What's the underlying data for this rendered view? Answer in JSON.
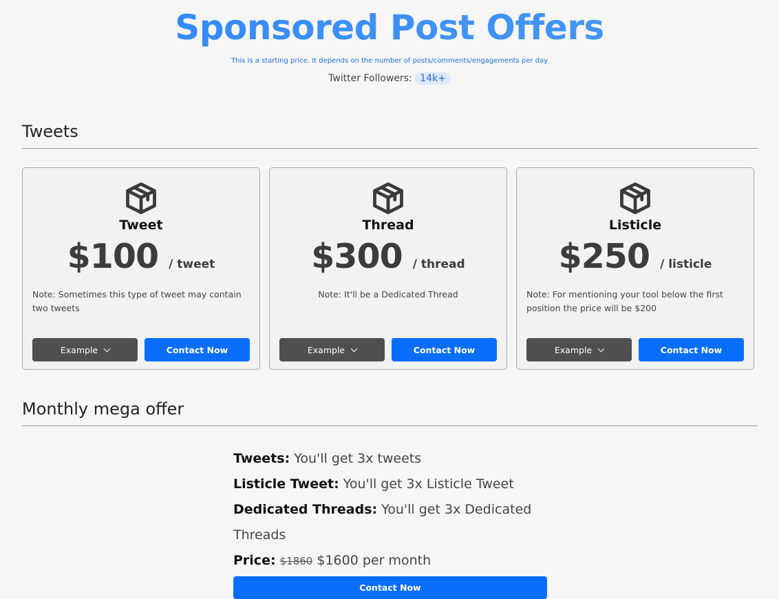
{
  "header": {
    "title": "Sponsored Post Offers",
    "subtitle": "This is a starting price. It depends on the number of posts/comments/engagements per day",
    "followers_label": "Twitter Followers:",
    "followers_count": "14k+"
  },
  "sections": {
    "tweets_title": "Tweets",
    "mega_title": "Monthly mega offer"
  },
  "cards": [
    {
      "icon": "box-icon",
      "name": "Tweet",
      "price": "$100",
      "per": "/ tweet",
      "note": "Note: Sometimes this type of tweet may contain two tweets",
      "example_label": "Example",
      "contact_label": "Contact Now"
    },
    {
      "icon": "box-icon",
      "name": "Thread",
      "price": "$300",
      "per": "/ thread",
      "note": "Note: It'll be a Dedicated Thread",
      "example_label": "Example",
      "contact_label": "Contact Now"
    },
    {
      "icon": "box-icon",
      "name": "Listicle",
      "price": "$250",
      "per": "/ listicle",
      "note": "Note: For mentioning your tool below the first position the price will be $200",
      "example_label": "Example",
      "contact_label": "Contact Now"
    }
  ],
  "mega": {
    "tweets_label": "Tweets:",
    "tweets_value": "You'll get 3x tweets",
    "listicle_label": "Listicle Tweet:",
    "listicle_value": "You'll get 3x Listicle Tweet",
    "threads_label": "Dedicated Threads:",
    "threads_value": "You'll get 3x Dedicated Threads",
    "price_label": "Price:",
    "old_price": "$1860",
    "new_price": "$1600 per month",
    "contact_label": "Contact Now"
  },
  "colors": {
    "title": "#2f86ff",
    "primary_button": "#0a6efd",
    "dark_button": "#4f4f4f",
    "background": "#f6f6f6"
  }
}
